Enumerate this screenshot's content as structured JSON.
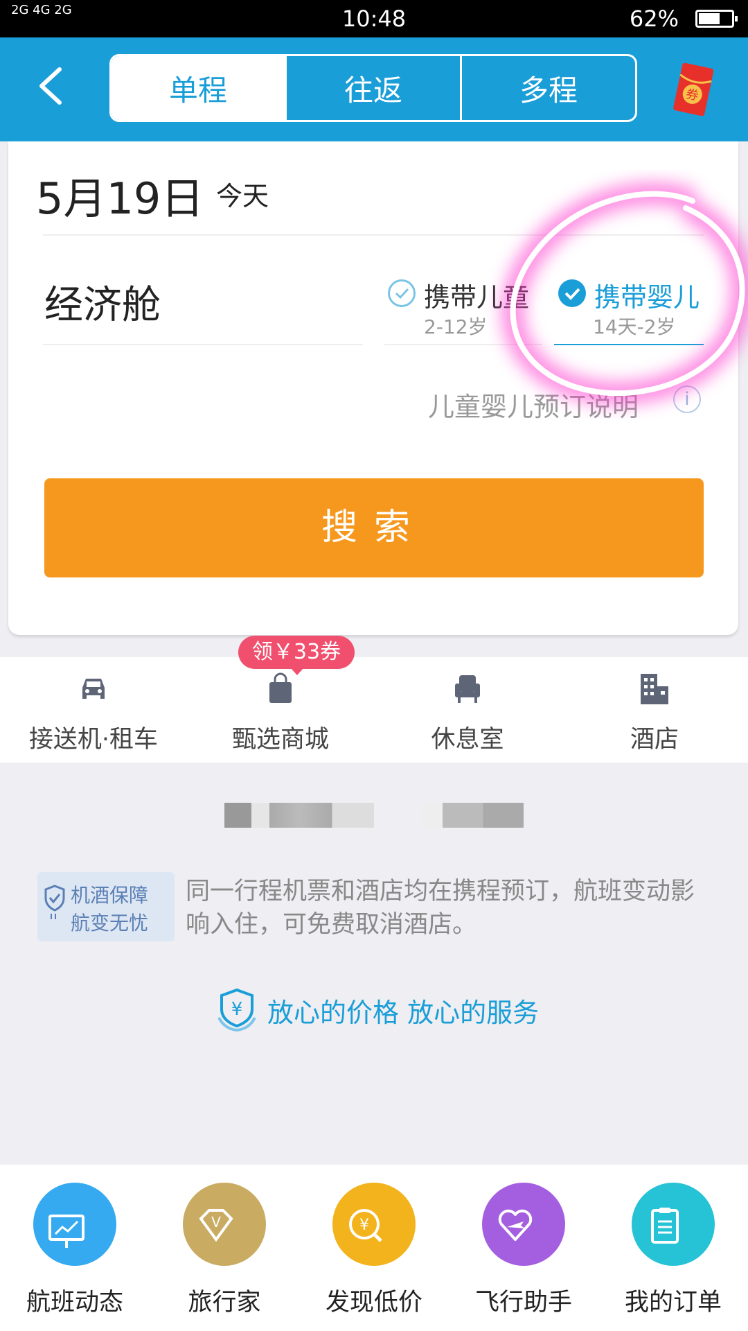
{
  "status_bar": {
    "signal": "2G 4G 2G",
    "time": "10:48",
    "battery": "62%"
  },
  "header": {
    "tabs": [
      {
        "label": "单程"
      },
      {
        "label": "往返"
      },
      {
        "label": "多程"
      }
    ],
    "coupon_icon_text": "券"
  },
  "form": {
    "date": "5月19日",
    "date_suffix": "今天",
    "cabin": "经济舱",
    "child_option": {
      "label": "携带儿童",
      "age": "2-12岁",
      "checked": false
    },
    "infant_option": {
      "label": "携带婴儿",
      "age": "14天-2岁",
      "checked": true
    },
    "booking_note": "儿童婴儿预订说明",
    "search_button": "搜索"
  },
  "services": {
    "badge": "领￥33券",
    "items": [
      {
        "label": "接送机·租车",
        "icon": "car-icon"
      },
      {
        "label": "甄选商城",
        "icon": "shopping-bag-icon"
      },
      {
        "label": "休息室",
        "icon": "lounge-chair-icon"
      },
      {
        "label": "酒店",
        "icon": "hotel-building-icon"
      }
    ]
  },
  "guarantee": {
    "line1": "机酒保障",
    "line2": "航变无忧",
    "description": "同一行程机票和酒店均在携程预订，航班变动影响入住，可免费取消酒店。",
    "promise": "放心的价格 放心的服务"
  },
  "bottom_nav": [
    {
      "label": "航班动态",
      "icon": "flight-status-icon",
      "color": "#35aaf0"
    },
    {
      "label": "旅行家",
      "icon": "traveler-v-icon",
      "color": "#c9ab62"
    },
    {
      "label": "发现低价",
      "icon": "low-price-search-icon",
      "color": "#f2b31c"
    },
    {
      "label": "飞行助手",
      "icon": "flight-helper-heart-icon",
      "color": "#a45ee0"
    },
    {
      "label": "我的订单",
      "icon": "my-orders-icon",
      "color": "#26c2d6"
    }
  ],
  "colors": {
    "primary": "#1a9ed8",
    "search_button": "#f6981e",
    "badge": "#f0506e",
    "annotation": "#ff33cc"
  }
}
